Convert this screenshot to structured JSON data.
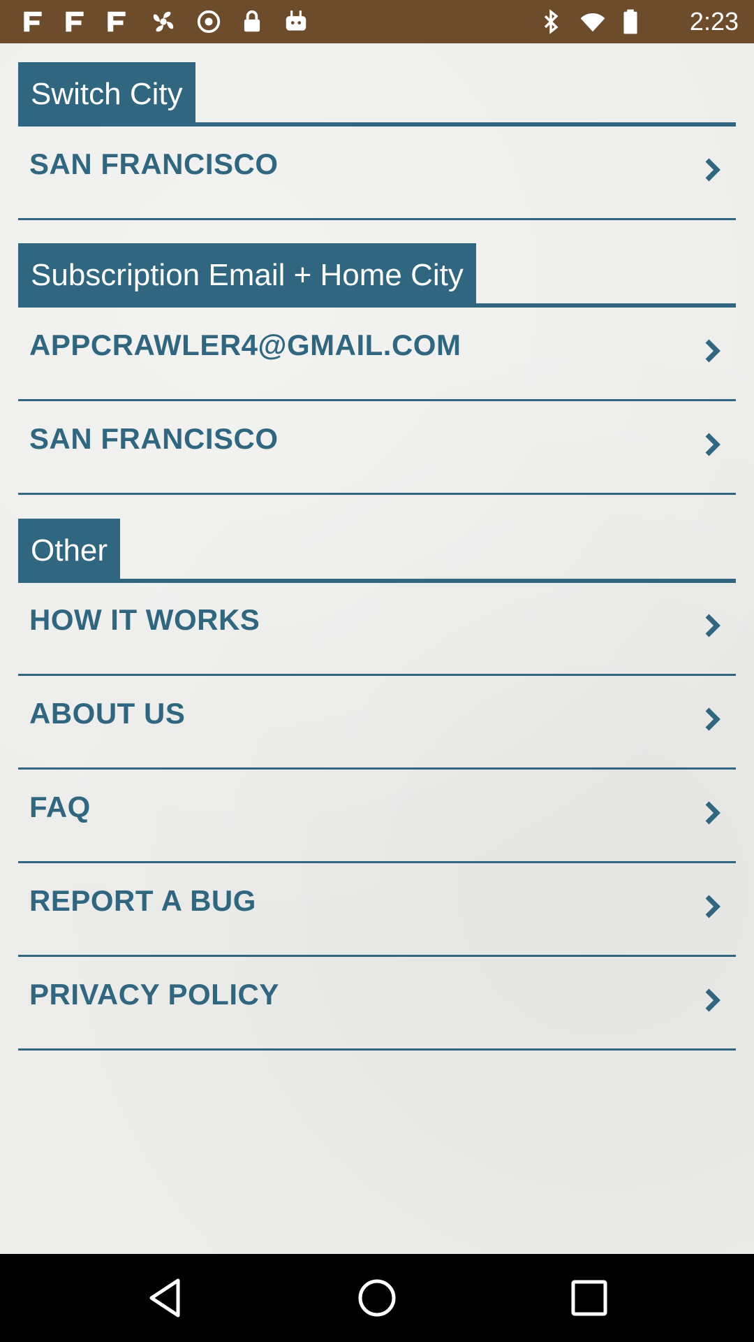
{
  "status_bar": {
    "time": "2:23",
    "left_icons": [
      "notification-icon",
      "notification-icon",
      "notification-icon",
      "fan-icon",
      "sync-icon",
      "lock-icon",
      "robot-icon"
    ],
    "right_icons": [
      "bluetooth-icon",
      "wifi-icon",
      "battery-icon"
    ],
    "background": "#6d4c2c"
  },
  "sections": {
    "switch_city": {
      "title": "Switch City",
      "items": [
        {
          "label": "SAN FRANCISCO"
        }
      ]
    },
    "subscription": {
      "title": "Subscription Email + Home City",
      "items": [
        {
          "label": "APPCRAWLER4@GMAIL.COM"
        },
        {
          "label": "SAN FRANCISCO"
        }
      ]
    },
    "other": {
      "title": "Other",
      "items": [
        {
          "label": "HOW IT WORKS"
        },
        {
          "label": "ABOUT US"
        },
        {
          "label": "FAQ"
        },
        {
          "label": "REPORT A BUG"
        },
        {
          "label": "PRIVACY POLICY"
        }
      ]
    }
  },
  "nav_bar": {
    "buttons": [
      "back-icon",
      "home-icon",
      "recents-icon"
    ]
  },
  "colors": {
    "accent": "#316680",
    "background": "#ececea"
  }
}
